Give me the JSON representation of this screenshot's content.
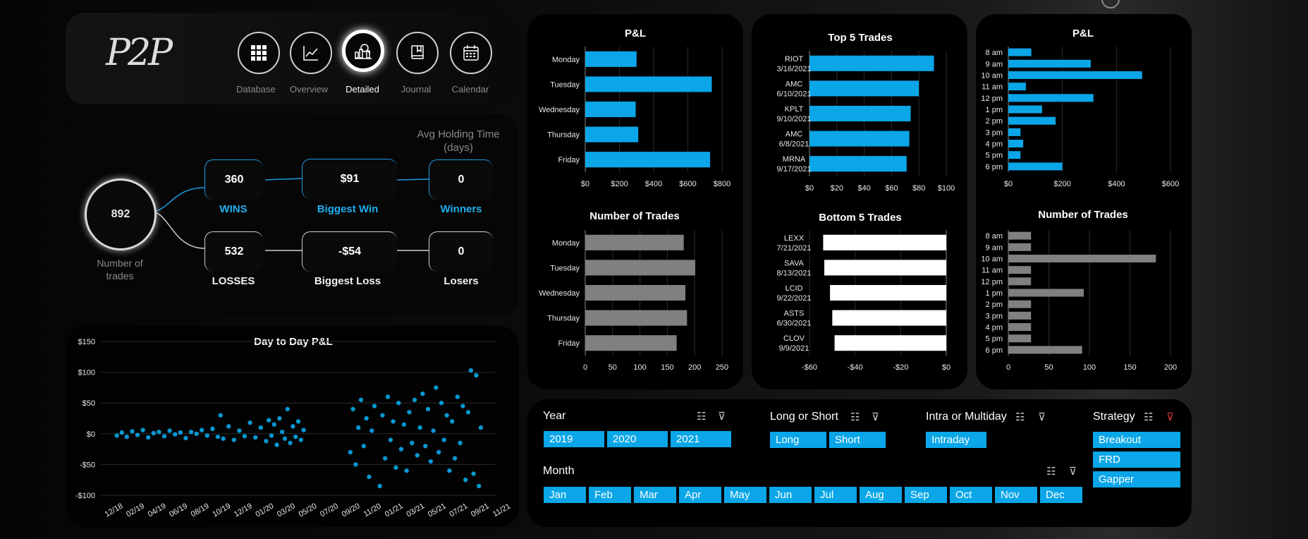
{
  "nav": {
    "logo": "P2P",
    "items": [
      {
        "label": "Database",
        "icon": "grid-icon"
      },
      {
        "label": "Overview",
        "icon": "line-chart-icon"
      },
      {
        "label": "Detailed",
        "icon": "bar-chart-magnifier-icon",
        "active": true
      },
      {
        "label": "Journal",
        "icon": "book-icon"
      },
      {
        "label": "Calendar",
        "icon": "calendar-icon"
      }
    ]
  },
  "stats": {
    "total": "892",
    "total_label": "Number of trades",
    "avg_holding_title": "Avg Holding Time (days)",
    "wins": "360",
    "wins_label": "WINS",
    "losses": "532",
    "losses_label": "LOSSES",
    "biggest_win": "$91",
    "biggest_win_label": "Biggest Win",
    "biggest_loss": "-$54",
    "biggest_loss_label": "Biggest Loss",
    "winners": "0",
    "winners_label": "Winners",
    "losers": "0",
    "losers_label": "Losers"
  },
  "colors": {
    "accent": "#0aa6e8",
    "gray_bar": "#808080",
    "white_bar": "#ffffff",
    "filter_active": "#e03a3a"
  },
  "chart_data": [
    {
      "id": "pl_weekday",
      "type": "bar",
      "orientation": "horizontal",
      "title": "P&L",
      "categories": [
        "Monday",
        "Tuesday",
        "Wednesday",
        "Thursday",
        "Friday"
      ],
      "values": [
        300,
        740,
        295,
        310,
        730
      ],
      "xlim": [
        0,
        800
      ],
      "ticks": [
        "$0",
        "$200",
        "$400",
        "$600",
        "$800"
      ],
      "tick_values": [
        0,
        200,
        400,
        600,
        800
      ]
    },
    {
      "id": "trades_weekday",
      "type": "bar",
      "orientation": "horizontal",
      "title": "Number of Trades",
      "categories": [
        "Monday",
        "Tuesday",
        "Wednesday",
        "Thursday",
        "Friday"
      ],
      "values": [
        180,
        201,
        183,
        186,
        167
      ],
      "xlim": [
        0,
        250
      ],
      "ticks": [
        "0",
        "50",
        "100",
        "150",
        "200",
        "250"
      ],
      "tick_values": [
        0,
        50,
        100,
        150,
        200,
        250
      ]
    },
    {
      "id": "top5",
      "type": "bar",
      "orientation": "horizontal",
      "title": "Top 5 Trades",
      "categories": [
        "RIOT 3/16/2021",
        "AMC 6/10/2021",
        "KPLT 9/10/2021",
        "AMC 6/8/2021",
        "MRNA 9/17/2021"
      ],
      "values": [
        91,
        80,
        74,
        73,
        71
      ],
      "xlim": [
        0,
        100
      ],
      "ticks": [
        "$0",
        "$20",
        "$40",
        "$60",
        "$80",
        "$100"
      ],
      "tick_values": [
        0,
        20,
        40,
        60,
        80,
        100
      ]
    },
    {
      "id": "bottom5",
      "type": "bar",
      "orientation": "horizontal",
      "title": "Bottom 5 Trades",
      "categories": [
        "LEXX 7/21/2021",
        "SAVA 8/13/2021",
        "LCID 9/22/2021",
        "ASTS 6/30/2021",
        "CLOV 9/9/2021"
      ],
      "values": [
        -54,
        -53.5,
        -51,
        -50,
        -49
      ],
      "xlim": [
        -60,
        0
      ],
      "ticks": [
        "-$60",
        "-$40",
        "-$20",
        "$0"
      ],
      "tick_values": [
        -60,
        -40,
        -20,
        0
      ]
    },
    {
      "id": "pl_hour",
      "type": "bar",
      "orientation": "horizontal",
      "title": "P&L",
      "categories": [
        "8 am",
        "9 am",
        "10 am",
        "11 am",
        "12 pm",
        "1 pm",
        "2 pm",
        "3 pm",
        "4 pm",
        "5 pm",
        "6 pm"
      ],
      "values": [
        85,
        305,
        495,
        65,
        315,
        125,
        175,
        45,
        55,
        45,
        200
      ],
      "xlim": [
        0,
        600
      ],
      "ticks": [
        "$0",
        "$200",
        "$400",
        "$600"
      ],
      "tick_values": [
        0,
        200,
        400,
        600
      ]
    },
    {
      "id": "trades_hour",
      "type": "bar",
      "orientation": "horizontal",
      "title": "Number of Trades",
      "categories": [
        "8 am",
        "9 am",
        "10 am",
        "11 am",
        "12 pm",
        "1 pm",
        "2 pm",
        "3 pm",
        "4 pm",
        "5 pm",
        "6 pm"
      ],
      "values": [
        28,
        28,
        182,
        28,
        28,
        93,
        28,
        28,
        28,
        28,
        91
      ],
      "xlim": [
        0,
        200
      ],
      "ticks": [
        "0",
        "50",
        "100",
        "150",
        "200"
      ],
      "tick_values": [
        0,
        50,
        100,
        150,
        200
      ]
    },
    {
      "id": "daytoday",
      "type": "scatter",
      "title": "Day to Day P&L",
      "ylim": [
        -100,
        150
      ],
      "yticks": [
        "$150",
        "$100",
        "$50",
        "$0",
        "-$50",
        "-$100"
      ],
      "ytick_values": [
        150,
        100,
        50,
        0,
        -50,
        -100
      ],
      "xticks": [
        "12/18",
        "02/19",
        "04/19",
        "06/19",
        "08/19",
        "10/19",
        "12/19",
        "01/20",
        "03/20",
        "05/20",
        "07/20",
        "09/20",
        "11/20",
        "01/21",
        "03/21",
        "05/21",
        "07/21",
        "09/21",
        "11/21"
      ],
      "x_range": [
        "2019-02-15",
        "2021-09-30"
      ],
      "gap": [
        "2020-06-25",
        "2020-10-20"
      ],
      "points": [
        [
          "2019-02-20",
          -3
        ],
        [
          "2019-03-05",
          2
        ],
        [
          "2019-03-18",
          -5
        ],
        [
          "2019-04-01",
          4
        ],
        [
          "2019-04-15",
          -2
        ],
        [
          "2019-04-29",
          6
        ],
        [
          "2019-05-13",
          -6
        ],
        [
          "2019-05-27",
          1
        ],
        [
          "2019-06-10",
          3
        ],
        [
          "2019-06-24",
          -4
        ],
        [
          "2019-07-08",
          5
        ],
        [
          "2019-07-22",
          -1
        ],
        [
          "2019-08-05",
          2
        ],
        [
          "2019-08-19",
          -7
        ],
        [
          "2019-09-02",
          3
        ],
        [
          "2019-09-16",
          0
        ],
        [
          "2019-09-30",
          6
        ],
        [
          "2019-10-14",
          -3
        ],
        [
          "2019-10-28",
          8
        ],
        [
          "2019-11-11",
          -5
        ],
        [
          "2019-11-18",
          30
        ],
        [
          "2019-11-25",
          -8
        ],
        [
          "2019-12-09",
          12
        ],
        [
          "2019-12-23",
          -10
        ],
        [
          "2020-01-06",
          5
        ],
        [
          "2020-01-20",
          -4
        ],
        [
          "2020-02-03",
          18
        ],
        [
          "2020-02-17",
          -6
        ],
        [
          "2020-03-02",
          10
        ],
        [
          "2020-03-16",
          -12
        ],
        [
          "2020-03-23",
          22
        ],
        [
          "2020-03-30",
          -3
        ],
        [
          "2020-04-06",
          15
        ],
        [
          "2020-04-13",
          -18
        ],
        [
          "2020-04-20",
          25
        ],
        [
          "2020-04-27",
          3
        ],
        [
          "2020-05-04",
          -8
        ],
        [
          "2020-05-11",
          40
        ],
        [
          "2020-05-18",
          -15
        ],
        [
          "2020-05-25",
          12
        ],
        [
          "2020-06-01",
          -5
        ],
        [
          "2020-06-08",
          20
        ],
        [
          "2020-06-15",
          -10
        ],
        [
          "2020-06-22",
          6
        ],
        [
          "2020-10-22",
          -30
        ],
        [
          "2020-10-29",
          40
        ],
        [
          "2020-11-05",
          -50
        ],
        [
          "2020-11-12",
          10
        ],
        [
          "2020-11-19",
          55
        ],
        [
          "2020-11-26",
          -20
        ],
        [
          "2020-12-03",
          25
        ],
        [
          "2020-12-10",
          -70
        ],
        [
          "2020-12-17",
          5
        ],
        [
          "2020-12-24",
          45
        ],
        [
          "2021-01-07",
          -85
        ],
        [
          "2021-01-14",
          30
        ],
        [
          "2021-01-21",
          -40
        ],
        [
          "2021-01-28",
          60
        ],
        [
          "2021-02-04",
          -10
        ],
        [
          "2021-02-11",
          20
        ],
        [
          "2021-02-18",
          -55
        ],
        [
          "2021-02-25",
          50
        ],
        [
          "2021-03-04",
          -25
        ],
        [
          "2021-03-11",
          15
        ],
        [
          "2021-03-18",
          -60
        ],
        [
          "2021-03-25",
          35
        ],
        [
          "2021-04-01",
          -15
        ],
        [
          "2021-04-08",
          55
        ],
        [
          "2021-04-15",
          -35
        ],
        [
          "2021-04-22",
          10
        ],
        [
          "2021-04-29",
          65
        ],
        [
          "2021-05-06",
          -20
        ],
        [
          "2021-05-13",
          40
        ],
        [
          "2021-05-20",
          -45
        ],
        [
          "2021-05-27",
          5
        ],
        [
          "2021-06-03",
          75
        ],
        [
          "2021-06-10",
          -30
        ],
        [
          "2021-06-17",
          50
        ],
        [
          "2021-06-24",
          -10
        ],
        [
          "2021-07-01",
          30
        ],
        [
          "2021-07-08",
          -60
        ],
        [
          "2021-07-15",
          20
        ],
        [
          "2021-07-22",
          -40
        ],
        [
          "2021-07-29",
          60
        ],
        [
          "2021-08-05",
          -15
        ],
        [
          "2021-08-12",
          45
        ],
        [
          "2021-08-19",
          -75
        ],
        [
          "2021-08-26",
          35
        ],
        [
          "2021-09-02",
          103
        ],
        [
          "2021-09-09",
          -65
        ],
        [
          "2021-09-16",
          95
        ],
        [
          "2021-09-23",
          -85
        ],
        [
          "2021-09-28",
          10
        ]
      ]
    }
  ],
  "slicers": {
    "year": {
      "title": "Year",
      "items": [
        "2019",
        "2020",
        "2021"
      ]
    },
    "long_short": {
      "title": "Long or Short",
      "items": [
        "Long",
        "Short"
      ]
    },
    "intra": {
      "title": "Intra or Multiday",
      "items": [
        "Intraday"
      ]
    },
    "strategy": {
      "title": "Strategy",
      "items": [
        "Breakout",
        "FRD",
        "Gapper"
      ]
    },
    "month": {
      "title": "Month",
      "items": [
        "Jan",
        "Feb",
        "Mar",
        "Apr",
        "May",
        "Jun",
        "Jul",
        "Aug",
        "Sep",
        "Oct",
        "Nov",
        "Dec"
      ]
    }
  }
}
